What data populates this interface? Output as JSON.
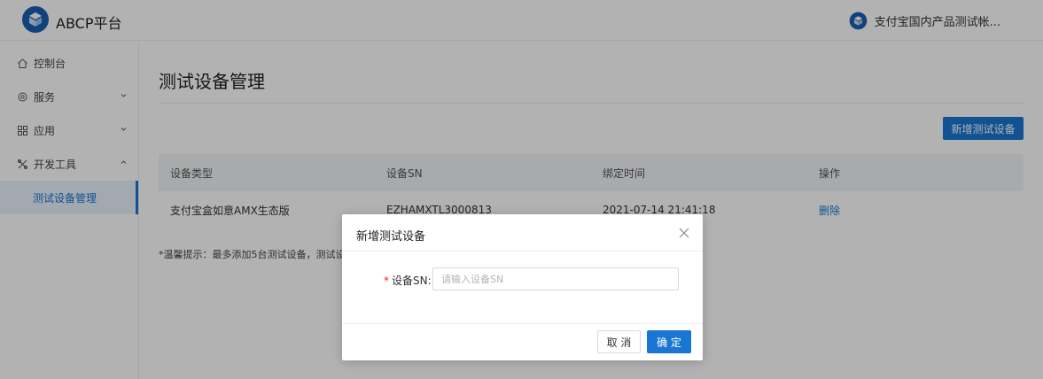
{
  "app": {
    "title": "ABCP平台",
    "logo_icon": "platform-cube-icon",
    "account": "支付宝国内产品测试帐...",
    "account_icon": "platform-cube-icon"
  },
  "colors": {
    "primary": "#1976d2",
    "required": "#f5222d",
    "overlay": "rgba(0,0,0,0.30)"
  },
  "sidebar": {
    "items": [
      {
        "label": "控制台",
        "icon": "home-icon"
      },
      {
        "label": "服务",
        "icon": "service-icon",
        "expandable": true,
        "expanded": false
      },
      {
        "label": "应用",
        "icon": "grid-icon",
        "expandable": true,
        "expanded": false
      },
      {
        "label": "开发工具",
        "icon": "dev-tools-icon",
        "expandable": true,
        "expanded": true
      },
      {
        "label": "测试设备管理",
        "active": true
      }
    ]
  },
  "main": {
    "title": "测试设备管理",
    "add_button": "新增测试设备",
    "table": {
      "columns": [
        "设备类型",
        "设备SN",
        "绑定时间",
        "操作"
      ],
      "rows": [
        {
          "type": "支付宝盒如意AMX生态版",
          "sn": "EZHAMXTL3000813",
          "time": "2021-07-14 21:41:18",
          "action": "删除"
        }
      ]
    },
    "tip": "*温馨提示：最多添加5台测试设备，测试设"
  },
  "modal": {
    "title": "新增测试设备",
    "close_icon": "close-icon",
    "field": {
      "required_mark": "*",
      "label": "设备SN",
      "colon": ":",
      "value": "",
      "placeholder": "请输入设备SN"
    },
    "cancel": "取 消",
    "ok": "确 定"
  }
}
